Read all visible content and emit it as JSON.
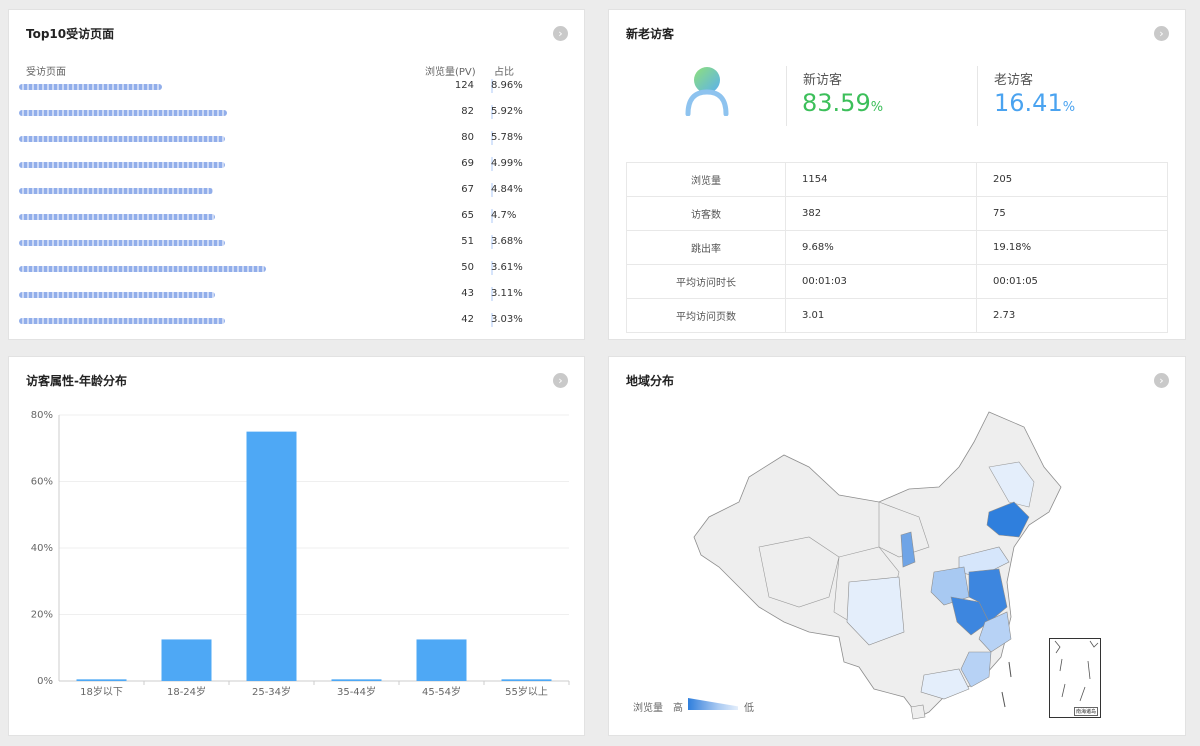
{
  "top10": {
    "title": "Top10受访页面",
    "col_page": "受访页面",
    "col_pv": "浏览量(PV)",
    "col_ratio": "占比",
    "rows": [
      {
        "pv": "124",
        "ratio": "8.96%"
      },
      {
        "pv": "82",
        "ratio": "5.92%"
      },
      {
        "pv": "80",
        "ratio": "5.78%"
      },
      {
        "pv": "69",
        "ratio": "4.99%"
      },
      {
        "pv": "67",
        "ratio": "4.84%"
      },
      {
        "pv": "65",
        "ratio": "4.7%"
      },
      {
        "pv": "51",
        "ratio": "3.68%"
      },
      {
        "pv": "50",
        "ratio": "3.61%"
      },
      {
        "pv": "43",
        "ratio": "3.11%"
      },
      {
        "pv": "42",
        "ratio": "3.03%"
      }
    ]
  },
  "visitors": {
    "title": "新老访客",
    "new_label": "新访客",
    "new_value": "83.59",
    "old_label": "老访客",
    "old_value": "16.41",
    "pct": "%",
    "new_color": "#3cbf5a",
    "old_color": "#4aa3f0",
    "table": [
      {
        "metric": "浏览量",
        "new": "1154",
        "old": "205"
      },
      {
        "metric": "访客数",
        "new": "382",
        "old": "75"
      },
      {
        "metric": "跳出率",
        "new": "9.68%",
        "old": "19.18%"
      },
      {
        "metric": "平均访问时长",
        "new": "00:01:03",
        "old": "00:01:05"
      },
      {
        "metric": "平均访问页数",
        "new": "3.01",
        "old": "2.73"
      }
    ]
  },
  "age": {
    "title": "访客属性-年龄分布",
    "y_ticks": [
      "0%",
      "20%",
      "40%",
      "60%",
      "80%"
    ]
  },
  "region": {
    "title": "地域分布",
    "legend_label": "浏览量",
    "legend_high": "高",
    "legend_low": "低",
    "inset_label": "南海诸岛"
  },
  "chart_data": {
    "type": "bar",
    "categories": [
      "18岁以下",
      "18-24岁",
      "25-34岁",
      "35-44岁",
      "45-54岁",
      "55岁以上"
    ],
    "values": [
      0.5,
      12.5,
      75,
      0.5,
      12.5,
      0.5
    ],
    "ylim": [
      0,
      80
    ],
    "y_unit": "%",
    "bar_color": "#4ea8f5",
    "grid": true
  }
}
